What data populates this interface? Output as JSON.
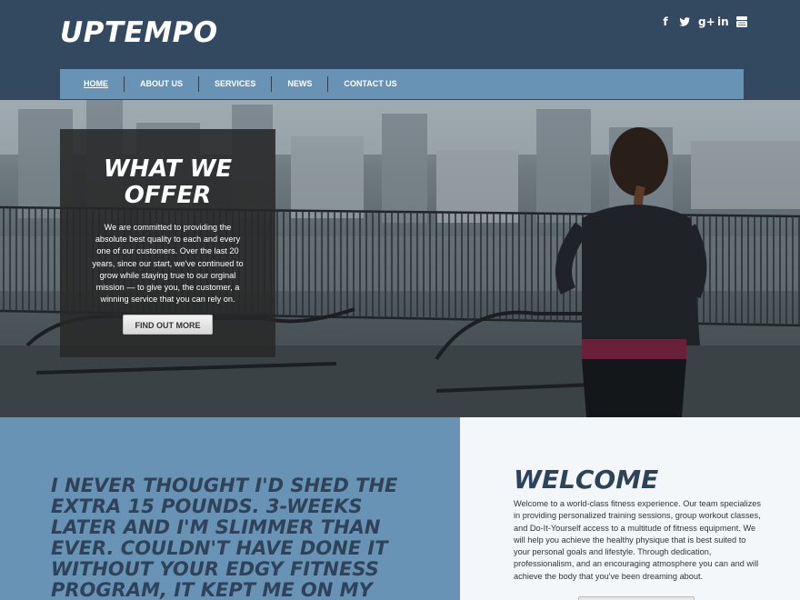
{
  "header": {
    "logo": "UPTEMPO",
    "social": [
      "facebook-icon",
      "twitter-icon",
      "google-plus-icon",
      "linkedin-icon",
      "youtube-icon"
    ]
  },
  "nav": {
    "items": [
      "HOME",
      "ABOUT US",
      "SERVICES",
      "NEWS",
      "CONTACT US"
    ],
    "active": "HOME"
  },
  "hero": {
    "title_line1": "WHAT WE",
    "title_line2": "OFFER",
    "text": "We are committed to providing the absolute best quality to each and every one of our customers. Over the last 20 years, since our start, we've continued to grow while staying true to our orginal mission — to give you, the customer, a winning service that you can rely on.",
    "button": "FIND OUT MORE"
  },
  "testimonial": {
    "quote": "I NEVER THOUGHT I'D SHED THE EXTRA 15 POUNDS. 3-WEEKS LATER AND I'M SLIMMER THAN EVER. COULDN'T HAVE DONE IT WITHOUT YOUR EDGY FITNESS PROGRAM, IT KEPT ME ON MY TOES (LITERALLY)."
  },
  "welcome": {
    "title": "WELCOME",
    "text": "Welcome to a world-class fitness experience. Our team specializes in providing personalized training sessions, group workout classes, and Do-It-Yourself access to a multitude of fitness equipment. We will help you achieve the healthy physique that is best suited to your personal goals and lifestyle. Through dedication, professionalism, and an encouraging atmosphere you can and will achieve the body that you've been dreaming about."
  },
  "colors": {
    "header_bg": "#334960",
    "nav_bg": "#6993b5",
    "quote_text": "#2e4359",
    "welcome_bg": "#f3f7fa"
  }
}
